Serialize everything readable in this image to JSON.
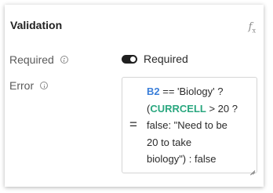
{
  "section": {
    "title": "Validation",
    "fx_icon": "fx-icon"
  },
  "required": {
    "label": "Required",
    "info_icon": "info-icon",
    "toggle_on": true,
    "toggle_label": "Required"
  },
  "error": {
    "label": "Error",
    "info_icon": "info-icon",
    "equals": "=",
    "formula_lines": [
      [
        {
          "t": "B2",
          "k": "ref"
        },
        {
          "t": " == 'Biology' ?",
          "k": "text"
        }
      ],
      [
        {
          "t": "(",
          "k": "text"
        },
        {
          "t": "CURRCELL",
          "k": "fn"
        },
        {
          "t": " > 20 ?",
          "k": "text"
        }
      ],
      [
        {
          "t": "false: \"Need to be",
          "k": "text"
        }
      ],
      [
        {
          "t": "20 to take",
          "k": "text"
        }
      ],
      [
        {
          "t": "biology\") : false",
          "k": "text"
        }
      ]
    ]
  },
  "colors": {
    "reference_token": "#3b7fd9",
    "function_token": "#2aa77f",
    "toggle_on": "#1f1f1f"
  }
}
